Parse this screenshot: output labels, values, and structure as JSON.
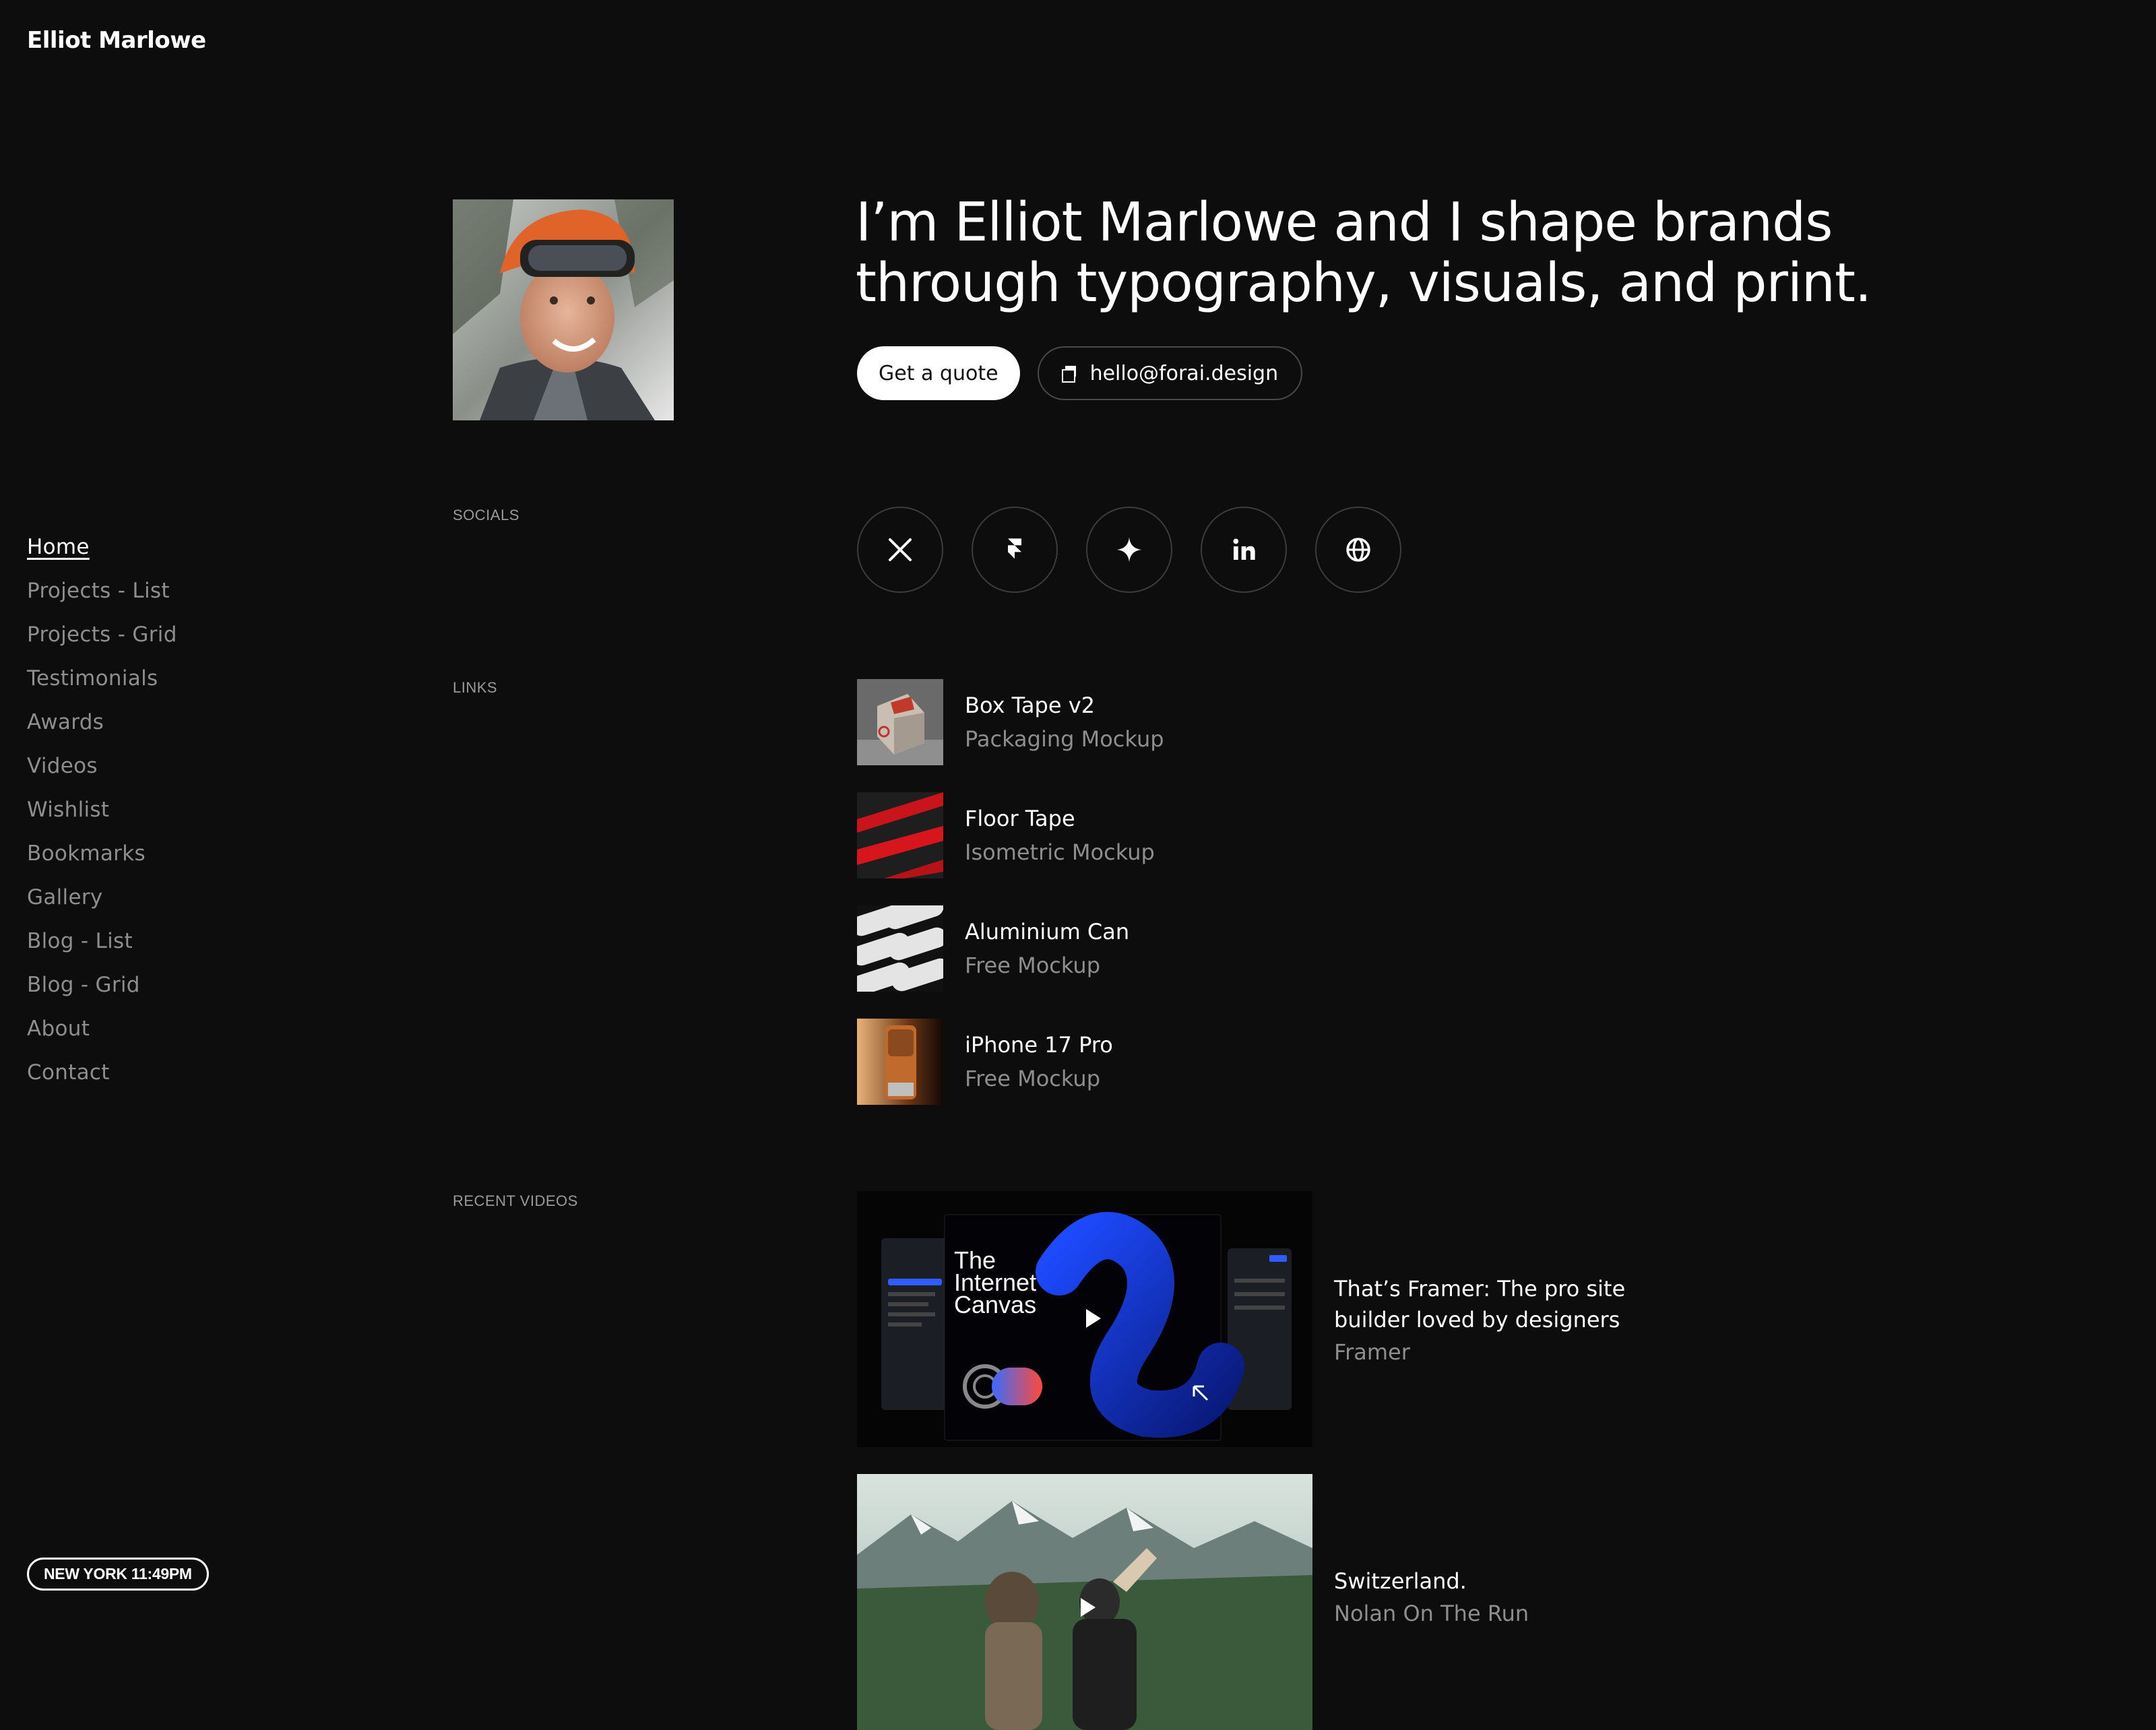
{
  "site": {
    "name": "Elliot Marlowe"
  },
  "nav": {
    "items": [
      {
        "label": "Home"
      },
      {
        "label": "Projects - List"
      },
      {
        "label": "Projects - Grid"
      },
      {
        "label": "Testimonials"
      },
      {
        "label": "Awards"
      },
      {
        "label": "Videos"
      },
      {
        "label": "Wishlist"
      },
      {
        "label": "Bookmarks"
      },
      {
        "label": "Gallery"
      },
      {
        "label": "Blog - List"
      },
      {
        "label": "Blog - Grid"
      },
      {
        "label": "About"
      },
      {
        "label": "Contact"
      }
    ],
    "active": "Home"
  },
  "clock": {
    "label": "NEW YORK 11:49PM"
  },
  "hero": {
    "headline_line1": "I’m Elliot Marlowe and I shape brands",
    "headline_line2": "through typography, visuals, and print.",
    "cta_label": "Get a quote",
    "email_label": "hello@forai.design"
  },
  "sections": {
    "socials_label": "SOCIALS",
    "links_label": "LINKS",
    "videos_label": "RECENT VIDEOS"
  },
  "socials": [
    {
      "icon": "x-icon"
    },
    {
      "icon": "framer-icon"
    },
    {
      "icon": "sparkle-icon"
    },
    {
      "icon": "linkedin-icon"
    },
    {
      "icon": "globe-icon"
    }
  ],
  "links": [
    {
      "title": "Box Tape v2",
      "subtitle": "Packaging Mockup"
    },
    {
      "title": "Floor Tape",
      "subtitle": "Isometric Mockup"
    },
    {
      "title": "Aluminium Can",
      "subtitle": "Free Mockup"
    },
    {
      "title": "iPhone 17 Pro",
      "subtitle": "Free Mockup"
    }
  ],
  "videos": [
    {
      "title_line1": "That’s Framer: The pro site",
      "title_line2": "builder loved by designers",
      "channel": "Framer",
      "thumb_text_1": "The",
      "thumb_text_2": "Internet",
      "thumb_text_3": "Canvas"
    },
    {
      "title_line1": "Switzerland.",
      "title_line2": "",
      "channel": "Nolan On The Run"
    }
  ],
  "colors": {
    "background": "#0d0d0d",
    "text_primary": "#ffffff",
    "text_muted": "#8e8e8e",
    "border": "#3c3c3c"
  }
}
